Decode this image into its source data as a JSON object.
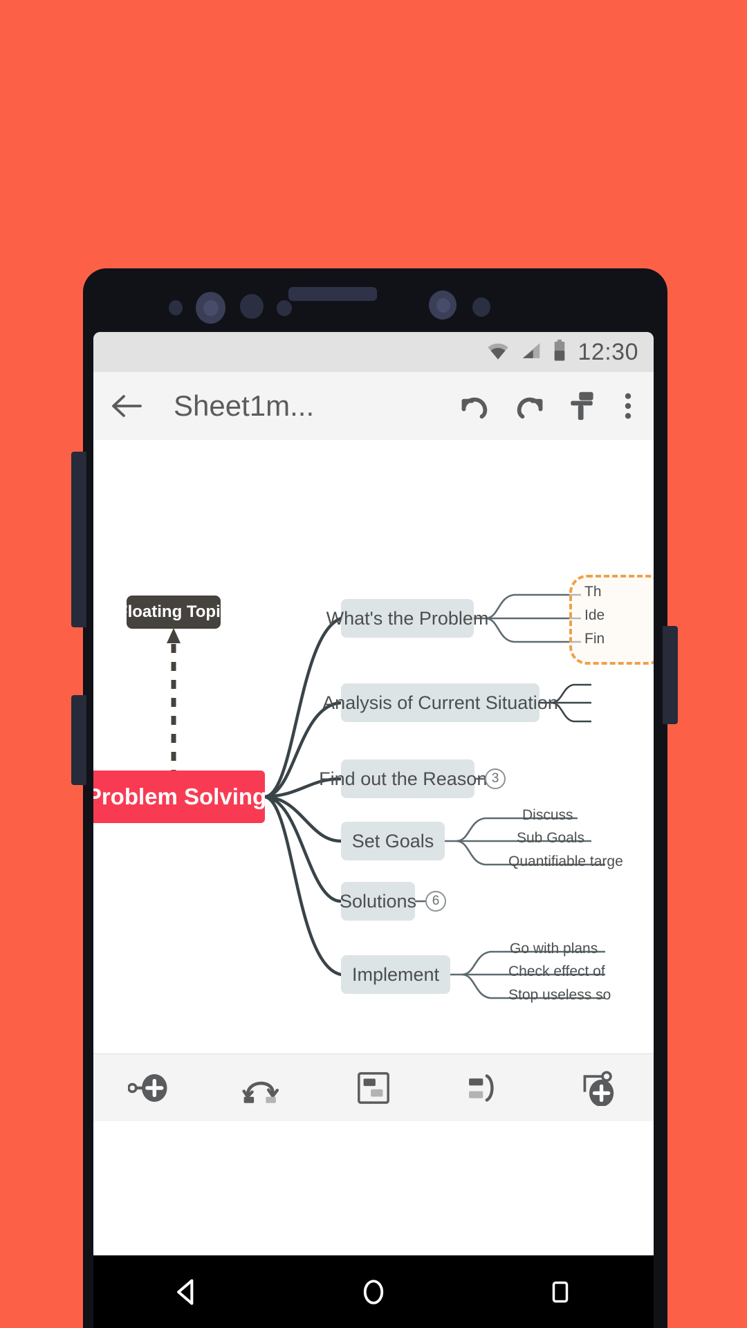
{
  "device": {
    "frame_color": "#111217",
    "background_color": "#FC6148"
  },
  "status_bar": {
    "time": "12:30",
    "icons": [
      "wifi-icon",
      "cellular-signal-icon",
      "battery-icon"
    ]
  },
  "toolbar": {
    "back_icon": "back-arrow-icon",
    "title": "Sheet1m...",
    "undo_icon": "undo-icon",
    "redo_icon": "redo-icon",
    "format_icon": "paint-roller-icon",
    "overflow_icon": "more-vertical-icon"
  },
  "mindmap": {
    "central": {
      "label": "Problem Solving",
      "color": "#f83b53",
      "text_color": "#ffffff"
    },
    "floating": {
      "label": "Floating Topic",
      "color": "#46423d",
      "text_color": "#ffffff"
    },
    "branch_color": "#dde4e5",
    "boundary_color": "#f0a04b",
    "branches": [
      {
        "label": "What's the Problem",
        "children": [
          "Th",
          "Ide",
          "Fin"
        ],
        "boundary": true,
        "badge": null
      },
      {
        "label": "Analysis of Current Situation",
        "children": [],
        "boundary": false,
        "badge": null
      },
      {
        "label": "Set Goals",
        "children": [
          "Discuss",
          "Sub Goals",
          "Quantifiable targe"
        ],
        "boundary": false,
        "badge": null
      },
      {
        "label": "Find out the Reasons",
        "children": [],
        "boundary": false,
        "badge": "3"
      },
      {
        "label": "Solutions",
        "children": [],
        "boundary": false,
        "badge": "6"
      },
      {
        "label": "Implement",
        "children": [
          "Go with plans",
          "Check effect of",
          "Stop useless so"
        ],
        "boundary": false,
        "badge": null
      }
    ]
  },
  "bottom_toolbar": {
    "items": [
      {
        "name": "add-subtopic-icon",
        "label": "Add Subtopic"
      },
      {
        "name": "add-relationship-icon",
        "label": "Relationship"
      },
      {
        "name": "add-boundary-icon",
        "label": "Boundary"
      },
      {
        "name": "add-summary-icon",
        "label": "Summary"
      },
      {
        "name": "add-floating-topic-icon",
        "label": "Floating Topic"
      }
    ]
  },
  "nav_bar": {
    "back": "nav-back-icon",
    "home": "nav-home-icon",
    "recents": "nav-recents-icon"
  }
}
